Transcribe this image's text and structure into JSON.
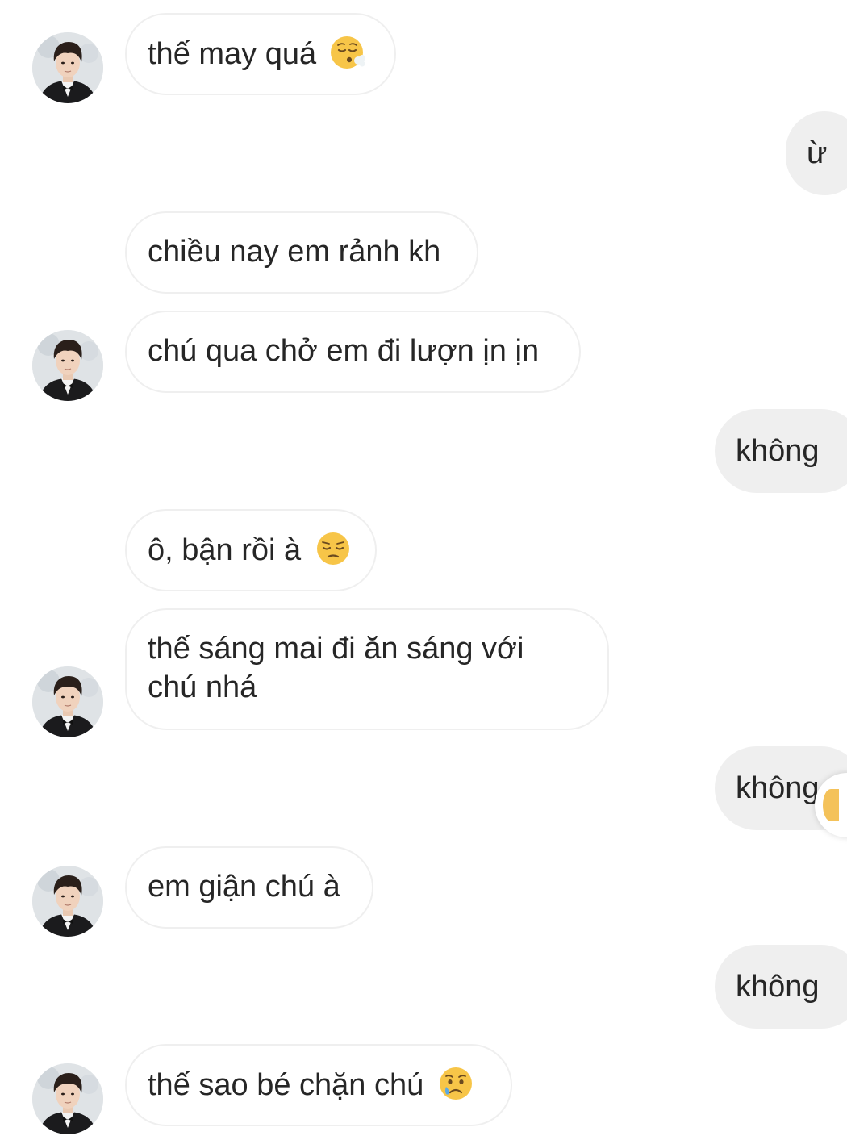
{
  "conversation": {
    "messages": [
      {
        "side": "in",
        "text": "thế may quá",
        "emoji": "face-exhaling-emoji",
        "avatar": true
      },
      {
        "side": "out",
        "text": "ừ"
      },
      {
        "side": "in",
        "text": "chiều nay em rảnh kh",
        "avatar": false
      },
      {
        "side": "in",
        "text": "chú qua chở em đi lượn ịn ịn",
        "avatar": true
      },
      {
        "side": "out",
        "text": "không"
      },
      {
        "side": "in",
        "text": "ô, bận rồi à",
        "emoji": "pensive-face-emoji",
        "avatar": false
      },
      {
        "side": "in",
        "text": "thế sáng mai đi ăn sáng với chú nhá",
        "avatar": true
      },
      {
        "side": "out",
        "text": "không"
      },
      {
        "side": "in",
        "text": "em giận chú à",
        "avatar": true
      },
      {
        "side": "out",
        "text": "không"
      },
      {
        "side": "in",
        "text": "thế sao bé chặn chú",
        "emoji": "crying-face-emoji",
        "avatar": true
      }
    ]
  },
  "colors": {
    "incoming_bubble_bg": "#ffffff",
    "incoming_bubble_border": "#efefef",
    "outgoing_bubble_bg": "#efefef",
    "text": "#262626",
    "emoji_yellow": "#f7c548"
  }
}
